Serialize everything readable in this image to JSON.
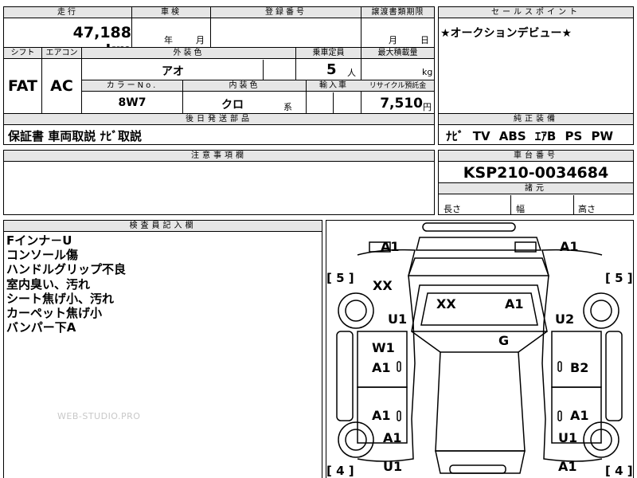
{
  "mileage": {
    "header": "走行",
    "value": "47,188",
    "unit": "km"
  },
  "shaken": {
    "header": "車検",
    "year_label": "年",
    "month_label": "月"
  },
  "registration": {
    "header": "登録番号"
  },
  "transfer_deadline": {
    "header": "譲渡書類期限",
    "month_label": "月",
    "day_label": "日"
  },
  "sales_point": {
    "header": "セールスポイント",
    "text": "★オークションデビュー★"
  },
  "shift": {
    "header": "シフト",
    "value": "FAT"
  },
  "aircon": {
    "header": "エアコン",
    "value": "AC"
  },
  "exterior_color": {
    "header": "外装色",
    "value": "アオ"
  },
  "capacity": {
    "header": "乗車定員",
    "value": "5",
    "unit": "人"
  },
  "max_load": {
    "header": "最大積載量",
    "unit": "kg"
  },
  "color_no": {
    "header": "カラーNo.",
    "value": "8W7"
  },
  "interior_color": {
    "header": "内装色",
    "value": "クロ",
    "suffix": "系"
  },
  "import": {
    "header": "輸入車"
  },
  "recycle": {
    "header": "リサイクル預託金",
    "value": "7,510",
    "unit": "円"
  },
  "post_delivery": {
    "header": "後日発送部品",
    "text": "保証書 車両取説 ﾅﾋﾞ取説"
  },
  "equipment": {
    "header": "純正装備",
    "text": "ﾅﾋﾞ TV ABS ｴｱB PS PW"
  },
  "notes": {
    "header": "注意事項欄"
  },
  "chassis": {
    "header": "車台番号",
    "value": "KSP210-0034684"
  },
  "dimensions": {
    "header": "諸元",
    "length_label": "長さ",
    "width_label": "幅",
    "height_label": "高さ"
  },
  "inspector": {
    "header": "検査員記入欄",
    "lines": [
      "Fインナ－U",
      "コンソール傷",
      "ハンドルグリップ不良",
      "室内臭い、汚れ",
      "シート焦げ小、汚れ",
      "カーペット焦げ小",
      "バンパー下A"
    ]
  },
  "watermark": "WEB-STUDIO.PRO",
  "damage_marks": {
    "front_left": "A1",
    "front_right": "A1",
    "tire_fl": "[ 5 ]",
    "tire_fr": "[ 5 ]",
    "fender_fl": "XX",
    "windshield_left": "XX",
    "windshield_right": "A1",
    "fender_fl_lower": "U1",
    "fender_fr": "U2",
    "door_fl_top": "W1",
    "door_fl": "A1",
    "roof": "G",
    "door_fr": "B2",
    "door_rl": "A1",
    "door_rr": "A1",
    "qtr_rl": "A1",
    "qtr_rr": "U1",
    "rear_l": "U1",
    "rear_r": "A1",
    "tire_rl": "[ 4 ]",
    "tire_rr": "[ 4 ]"
  }
}
